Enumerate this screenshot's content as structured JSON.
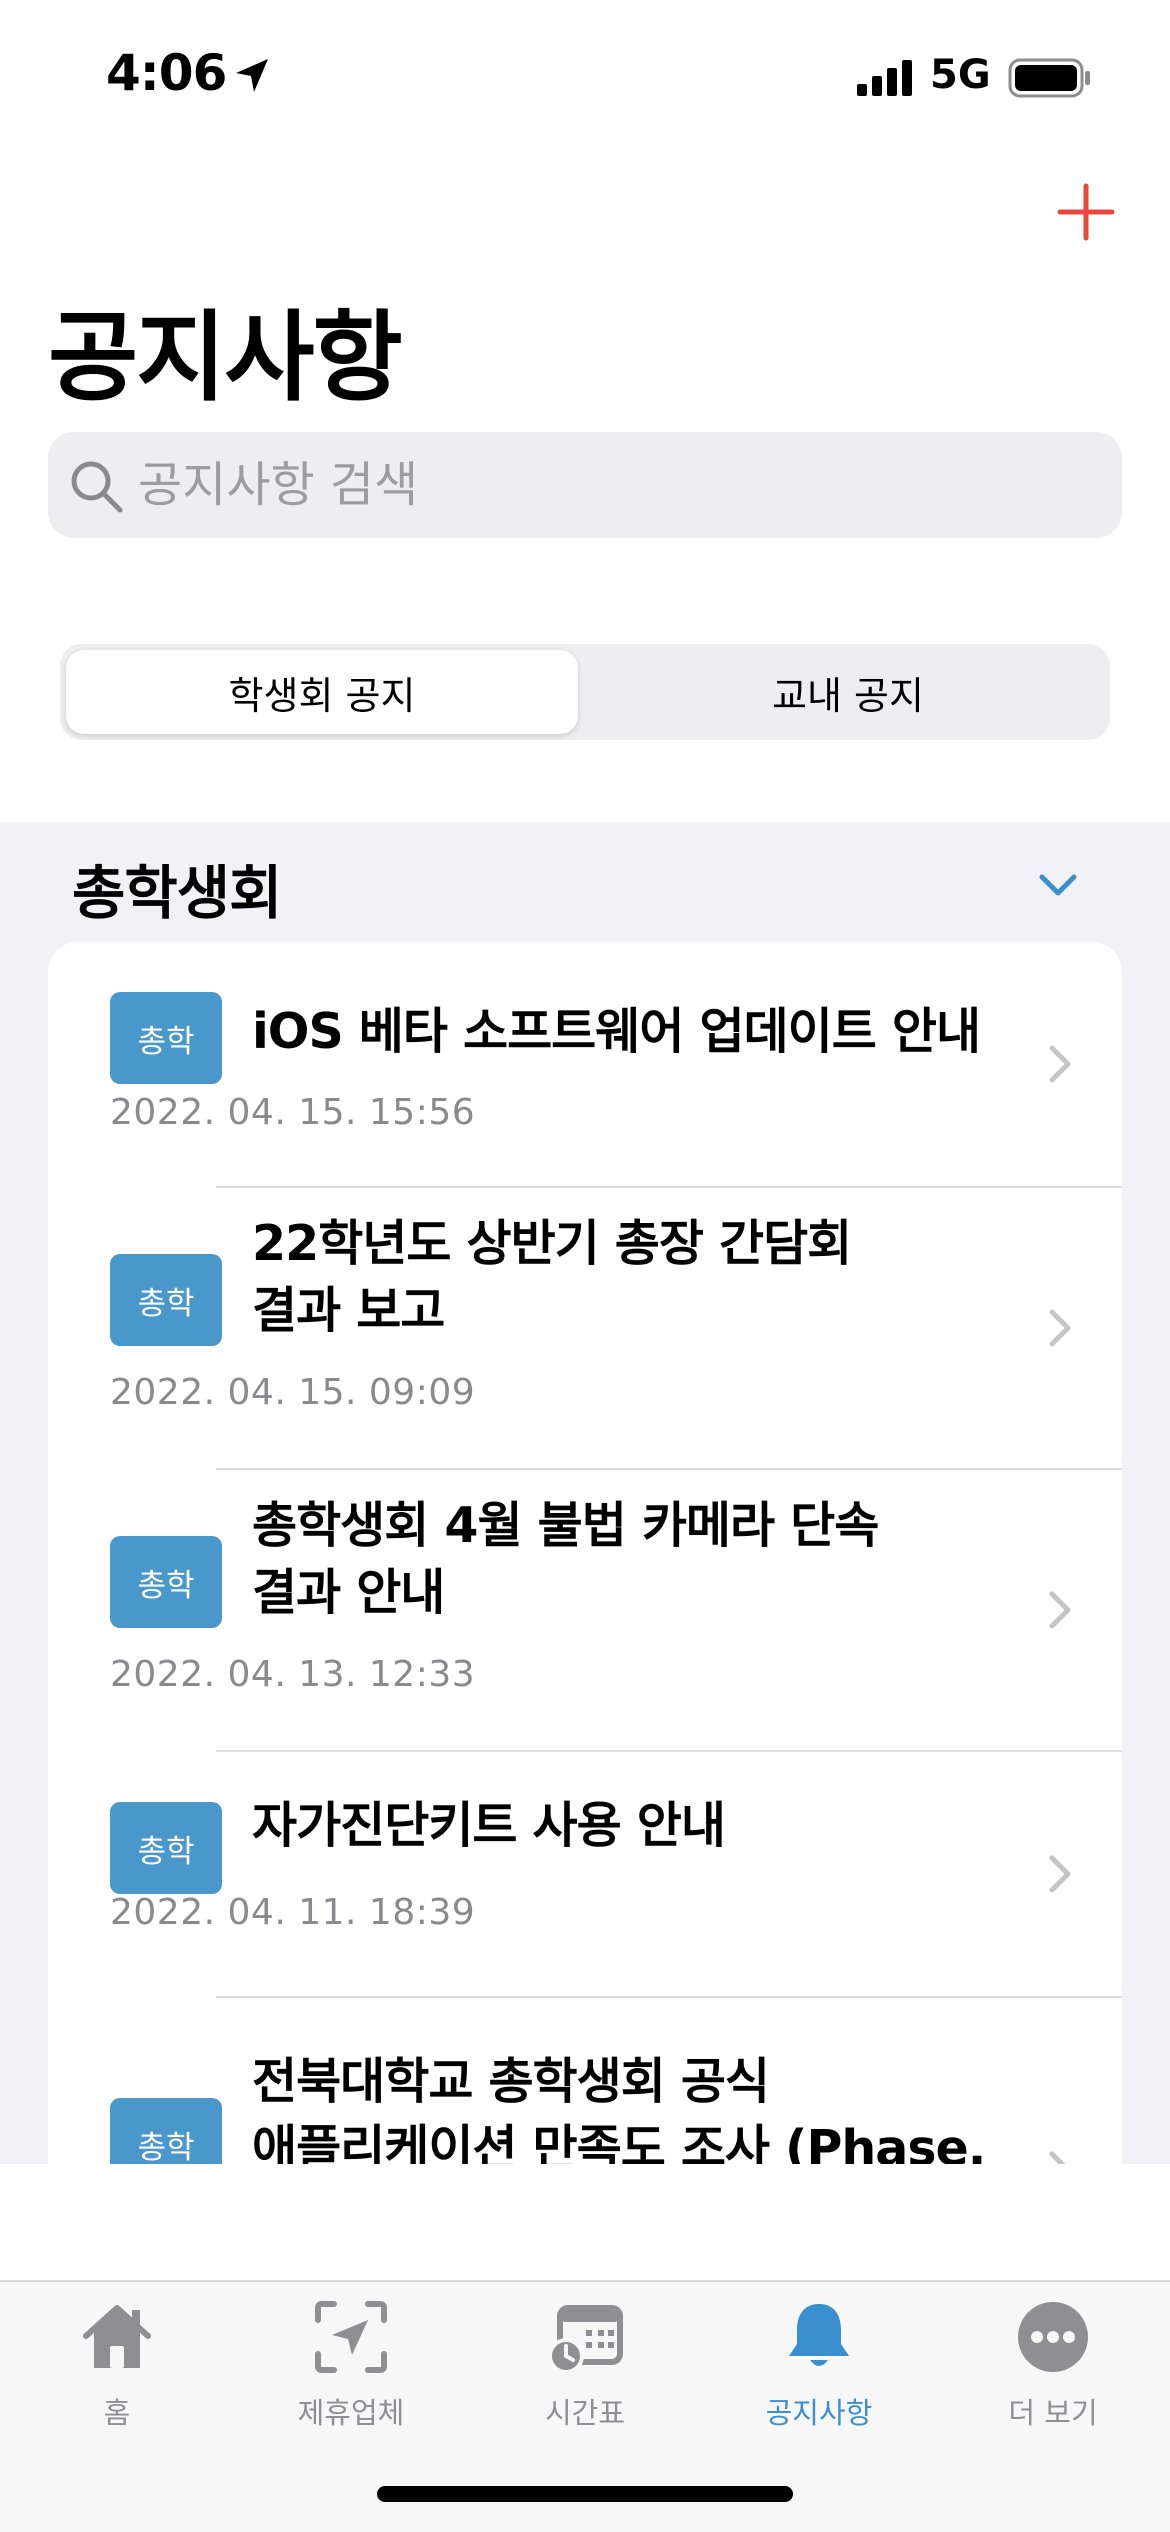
{
  "status_bar": {
    "time": "4:06",
    "network": "5G",
    "icons": [
      "location-arrow-icon",
      "signal-bars-icon",
      "battery-icon"
    ]
  },
  "header": {
    "title": "공지사항",
    "add_icon": "plus-icon",
    "accent_color": "#e8473b"
  },
  "search": {
    "placeholder": "공지사항 검색",
    "value": ""
  },
  "segments": {
    "items": [
      "학생회 공지",
      "교내 공지"
    ],
    "selected": "학생회 공지"
  },
  "section": {
    "title": "총학생회",
    "toggle_icon": "chevron-down-icon"
  },
  "notices": [
    {
      "badge": "총학",
      "title_lines": [
        "iOS 베타 소프트웨어 업데이트 안내"
      ],
      "date": "2022. 04. 15. 15:56"
    },
    {
      "badge": "총학",
      "title_lines": [
        "22학년도 상반기 총장 간담회",
        "결과 보고"
      ],
      "date": "2022. 04. 15. 09:09"
    },
    {
      "badge": "총학",
      "title_lines": [
        "총학생회 4월 불법 카메라 단속",
        "결과 안내"
      ],
      "date": "2022. 04. 13. 12:33"
    },
    {
      "badge": "총학",
      "title_lines": [
        "자가진단키트 사용 안내"
      ],
      "date": "2022. 04. 11. 18:39"
    },
    {
      "badge": "총학",
      "title_lines": [
        "전북대학교 총학생회 공식",
        "애플리케이션 만족도 조사 (Phase."
      ],
      "date": ""
    }
  ],
  "tab_bar": {
    "tabs": [
      {
        "label": "홈",
        "icon": "house-icon"
      },
      {
        "label": "제휴업체",
        "icon": "location-scan-icon"
      },
      {
        "label": "시간표",
        "icon": "calendar-clock-icon"
      },
      {
        "label": "공지사항",
        "icon": "bell-icon"
      },
      {
        "label": "더 보기",
        "icon": "ellipsis-circle-icon"
      }
    ],
    "selected": "공지사항",
    "active_color": "#3a8fcf",
    "inactive_color": "#8e8e93"
  },
  "colors": {
    "badge": "#4a97cb",
    "list_background": "#f1f1f6",
    "chevron_accent": "#3a8fcf"
  }
}
